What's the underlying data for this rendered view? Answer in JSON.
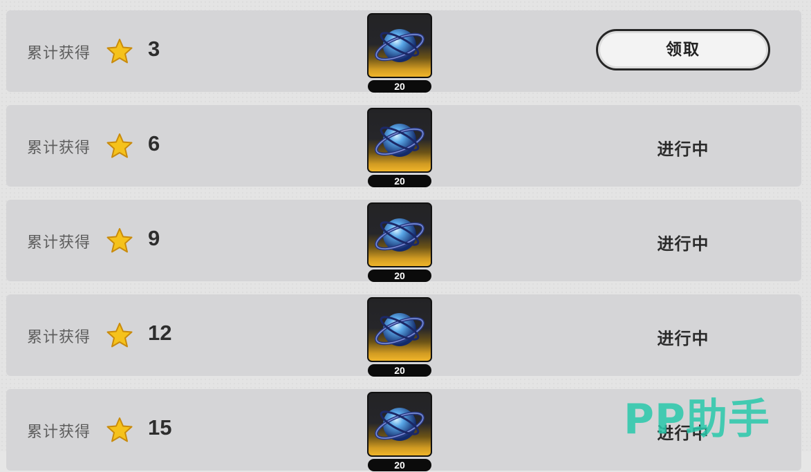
{
  "reward_rows": [
    {
      "label": "累计获得",
      "count": "3",
      "reward_qty": "20",
      "action": "领取",
      "state": "claimable"
    },
    {
      "label": "累计获得",
      "count": "6",
      "reward_qty": "20",
      "action": "进行中",
      "state": "in_progress"
    },
    {
      "label": "累计获得",
      "count": "9",
      "reward_qty": "20",
      "action": "进行中",
      "state": "in_progress"
    },
    {
      "label": "累计获得",
      "count": "12",
      "reward_qty": "20",
      "action": "进行中",
      "state": "in_progress"
    },
    {
      "label": "累计获得",
      "count": "15",
      "reward_qty": "20",
      "action": "进行中",
      "state": "in_progress"
    }
  ],
  "icons": {
    "star": "star-icon",
    "reward_item": "crystal-orb-icon"
  },
  "colors": {
    "star": "#f5c21c",
    "row_bg": "#d5d5d7",
    "reward_gold": "#f0b52a"
  },
  "watermark": "PP助手"
}
